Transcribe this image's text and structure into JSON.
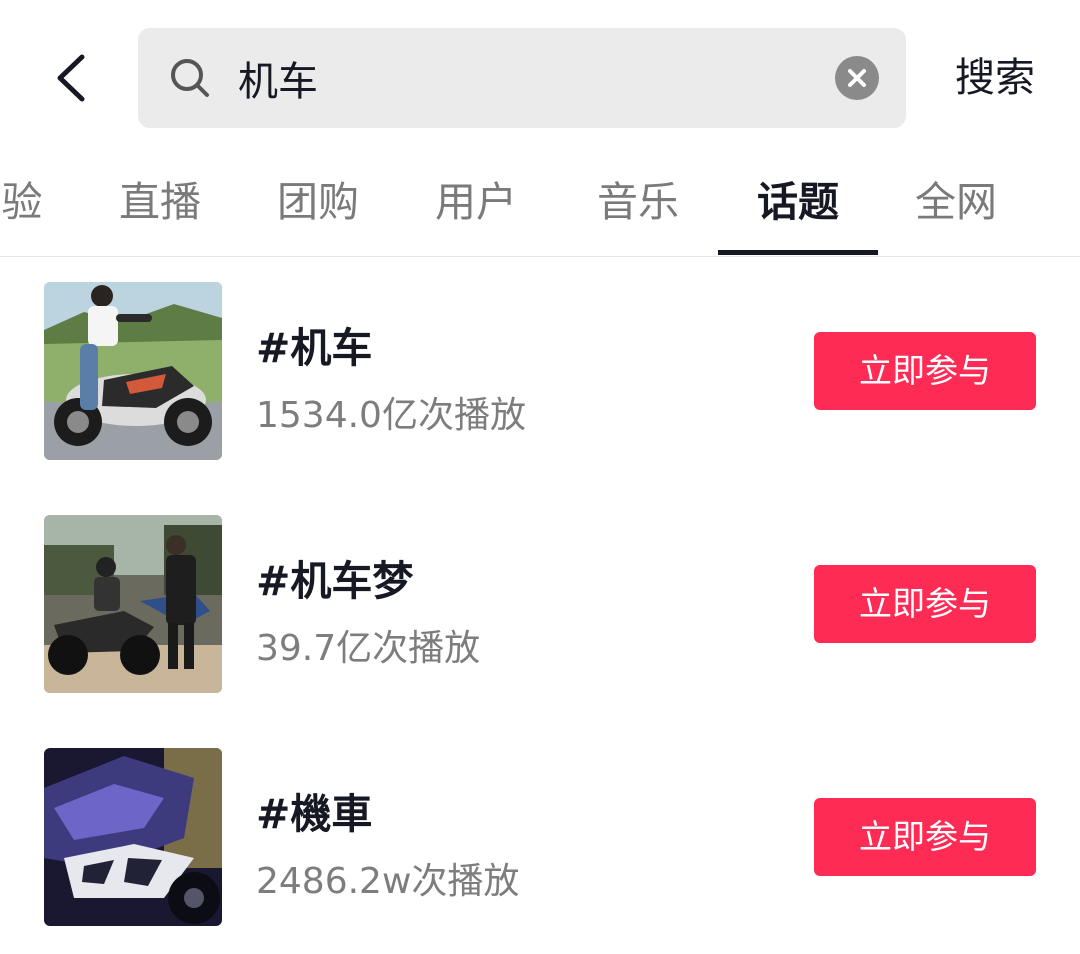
{
  "header": {
    "search_value": "机车",
    "search_button_label": "搜索"
  },
  "tabs": [
    {
      "label": "验",
      "active": false
    },
    {
      "label": "直播",
      "active": false
    },
    {
      "label": "团购",
      "active": false
    },
    {
      "label": "用户",
      "active": false
    },
    {
      "label": "音乐",
      "active": false
    },
    {
      "label": "话题",
      "active": true
    },
    {
      "label": "全网",
      "active": false
    }
  ],
  "results": [
    {
      "title": "#机车",
      "plays": "1534.0亿次播放",
      "button_label": "立即参与"
    },
    {
      "title": "#机车梦",
      "plays": "39.7亿次播放",
      "button_label": "立即参与"
    },
    {
      "title": "#機車",
      "plays": "2486.2w次播放",
      "button_label": "立即参与"
    }
  ],
  "colors": {
    "accent": "#fe2c55",
    "text_primary": "#161823",
    "text_secondary": "#7d7d7d",
    "search_bg": "#ebebeb"
  },
  "icons": {
    "back": "chevron-left-icon",
    "search": "search-icon",
    "clear": "clear-icon"
  }
}
